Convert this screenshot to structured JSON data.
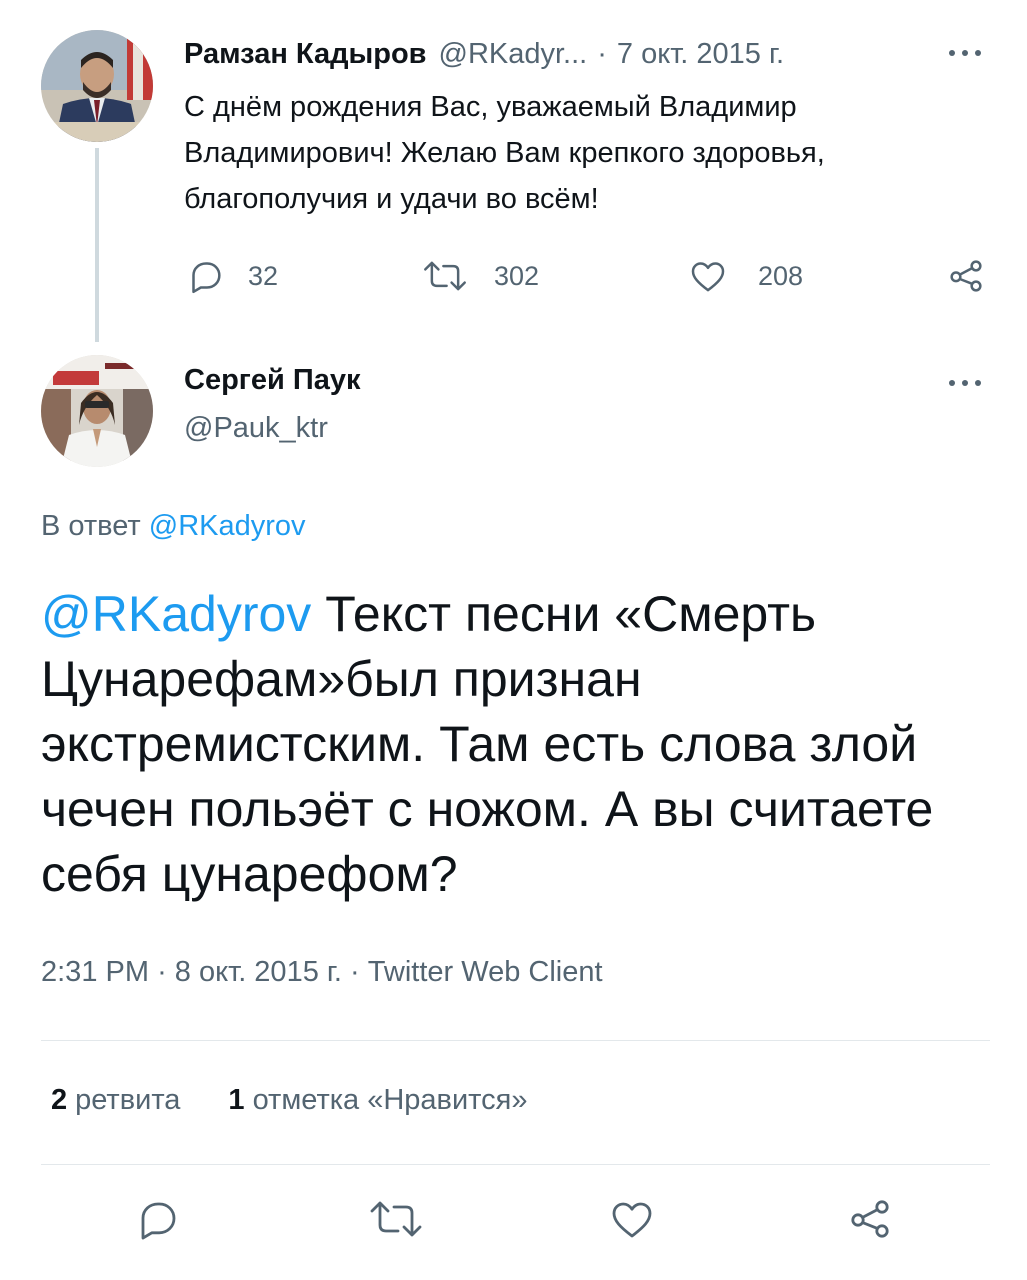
{
  "parent_tweet": {
    "author_name": "Рамзан Кадыров",
    "author_handle": "@RKadyr...",
    "separator": "·",
    "date": "7 окт. 2015 г.",
    "text": "С днём рождения Вас, уважаемый Владимир Владимирович! Желаю Вам крепкого здоровья, благополучия и удачи во всём!",
    "replies_count": "32",
    "retweets_count": "302",
    "likes_count": "208"
  },
  "main_tweet": {
    "author_name": "Сергей Паук",
    "author_handle": "@Pauk_ktr",
    "reply_to_prefix": "В ответ",
    "reply_to_handle": "@RKadyrov",
    "mention": "@RKadyrov",
    "text": " Текст песни «Смерть Цунарефам»был признан экстремистским. Там есть слова злой чечен польэёт с ножом. А вы считаете себя цунарефом?",
    "time": "2:31 PM",
    "separator": "·",
    "date": "8 окт. 2015 г.",
    "client": "Twitter Web Client",
    "retweets_num": "2",
    "retweets_label": "ретвита",
    "likes_num": "1",
    "likes_label": "отметка «Нравится»"
  },
  "icons": {
    "reply": "reply-icon",
    "retweet": "retweet-icon",
    "like": "heart-icon",
    "share": "share-icon",
    "more": "more-icon"
  },
  "colors": {
    "link": "#1d9bf0",
    "muted": "#536471",
    "text": "#0f1419",
    "thread_line": "#cfd9de"
  }
}
